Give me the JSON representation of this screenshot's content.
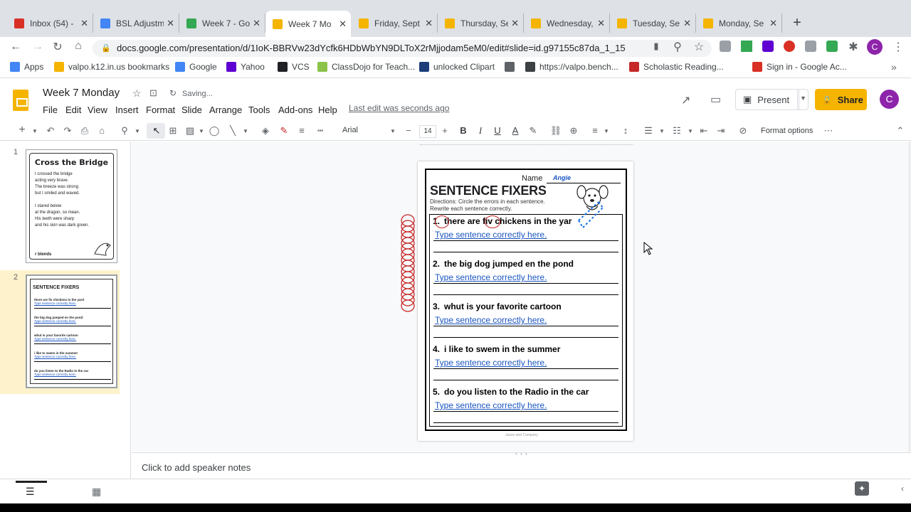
{
  "browser": {
    "tabs": [
      {
        "title": "Inbox (54) -",
        "icon": "gmail-icon",
        "color": "#d93025"
      },
      {
        "title": "BSL Adjustm",
        "icon": "docs-icon",
        "color": "#4285f4"
      },
      {
        "title": "Week 7 - Go",
        "icon": "drive-icon",
        "color": "#34a853"
      },
      {
        "title": "Week 7 Mo",
        "icon": "slides-icon",
        "color": "#f4b400",
        "active": true
      },
      {
        "title": "Friday, Sept",
        "icon": "slides-icon",
        "color": "#f4b400"
      },
      {
        "title": "Thursday, Se",
        "icon": "slides-icon",
        "color": "#f4b400"
      },
      {
        "title": "Wednesday,",
        "icon": "slides-icon",
        "color": "#f4b400"
      },
      {
        "title": "Tuesday, Se",
        "icon": "slides-icon",
        "color": "#f4b400"
      },
      {
        "title": "Monday, Se",
        "icon": "slides-icon",
        "color": "#f4b400"
      }
    ],
    "close_glyph": "✕",
    "new_tab_glyph": "+",
    "url": "docs.google.com/presentation/d/1IoK-BBRVw23dYcfk6HDbWbYN9DLToX2rMjjodam5eM0/edit#slide=id.g97155c87da_1_15",
    "bookmarks": [
      {
        "label": "Apps",
        "icon": "apps-grid-icon",
        "color": "#4285f4"
      },
      {
        "label": "valpo.k12.in.us bookmarks",
        "icon": "folder-icon",
        "color": "#f4b400"
      },
      {
        "label": "Google",
        "icon": "google-icon",
        "color": "#4285f4"
      },
      {
        "label": "Yahoo",
        "icon": "yahoo-icon",
        "color": "#5f01d1"
      },
      {
        "label": "VCS",
        "icon": "vcs-icon",
        "color": "#202124"
      },
      {
        "label": "ClassDojo for Teach...",
        "icon": "classdojo-icon",
        "color": "#8bc34a"
      },
      {
        "label": "unlocked Clipart",
        "icon": "clipart-icon",
        "color": "#1a3d7a"
      },
      {
        "label": "",
        "icon": "globe-icon",
        "color": "#5f6368"
      },
      {
        "label": "https://valpo.bench...",
        "icon": "bench-icon",
        "color": "#3c4043"
      },
      {
        "label": "Scholastic Reading...",
        "icon": "scholastic-icon",
        "color": "#c62828"
      },
      {
        "label": "Sign in - Google Ac...",
        "icon": "gmail-icon",
        "color": "#d93025"
      }
    ],
    "more_bookmarks": "»"
  },
  "app": {
    "title": "Week 7 Monday",
    "saving": "Saving...",
    "menus": [
      "File",
      "Edit",
      "View",
      "Insert",
      "Format",
      "Slide",
      "Arrange",
      "Tools",
      "Add-ons",
      "Help"
    ],
    "last_edit": "Last edit was seconds ago",
    "present": "Present",
    "share": "Share",
    "avatar": "C",
    "accent": "#f4b400"
  },
  "toolbar": {
    "font": "Arial",
    "font_size": "14",
    "format_options": "Format options"
  },
  "filmstrip": {
    "slides": [
      {
        "num": "1",
        "title": "Cross the Bridge",
        "lines": [
          "I crossed the bridge",
          "acting very brave.",
          "The breeze was strong",
          "but I smiled and waved.",
          "",
          "I stared below",
          "at the dragon, so mean.",
          "His teeth were sharp",
          "and his skin was dark green."
        ],
        "footer": "r blends"
      },
      {
        "num": "2",
        "title": "SENTENCE FIXERS",
        "lines": [
          "there are fiv chickens in the yard",
          "the big dog jumped en the pond",
          "whut is your favorite cartoon",
          "i like to swem in the summer",
          "do you listen to the Radio in the car"
        ]
      }
    ]
  },
  "worksheet": {
    "name_label": "Name",
    "name_value": "Angie",
    "title": "SENTENCE FIXERS",
    "directions": [
      "Directions:  Circle the errors in each sentence.",
      "Rewrite each sentence correctly."
    ],
    "items": [
      {
        "num": "1.",
        "text": "there are fiv chickens in the yar"
      },
      {
        "num": "2.",
        "text": "the big dog jumped en the pond"
      },
      {
        "num": "3.",
        "text": "whut is your favorite cartoon"
      },
      {
        "num": "4.",
        "text": "i like to swem in the summer"
      },
      {
        "num": "5.",
        "text": "do you listen to the Radio in the car"
      }
    ],
    "placeholder": "Type sentence correctly here.",
    "footer": "Jason and Company"
  },
  "notes": {
    "placeholder": "Click to add speaker notes"
  }
}
